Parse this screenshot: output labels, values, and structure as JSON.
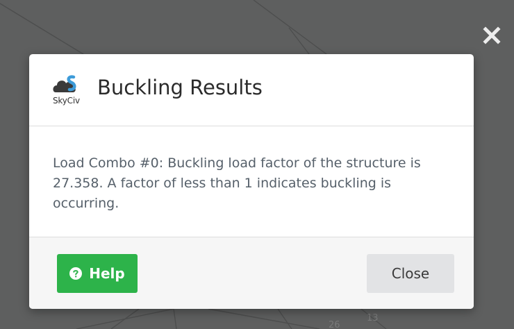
{
  "dialog": {
    "title": "Buckling Results",
    "logo_text": "SkyCiv",
    "message": "Load Combo #0: Buckling load factor of the structure is 27.358. A factor of less than 1 indicates buckling is occurring.",
    "help_label": "Help",
    "close_label": "Close"
  },
  "background": {
    "node_labels": [
      "26",
      "13"
    ]
  },
  "icons": {
    "corner_close": "close-icon",
    "help": "question-circle-icon",
    "logo": "skyciv-logo"
  },
  "colors": {
    "overlay": "#5e5f5f",
    "help_button": "#2db34a",
    "close_button": "#e2e3e5",
    "footer": "#f6f6f6"
  }
}
